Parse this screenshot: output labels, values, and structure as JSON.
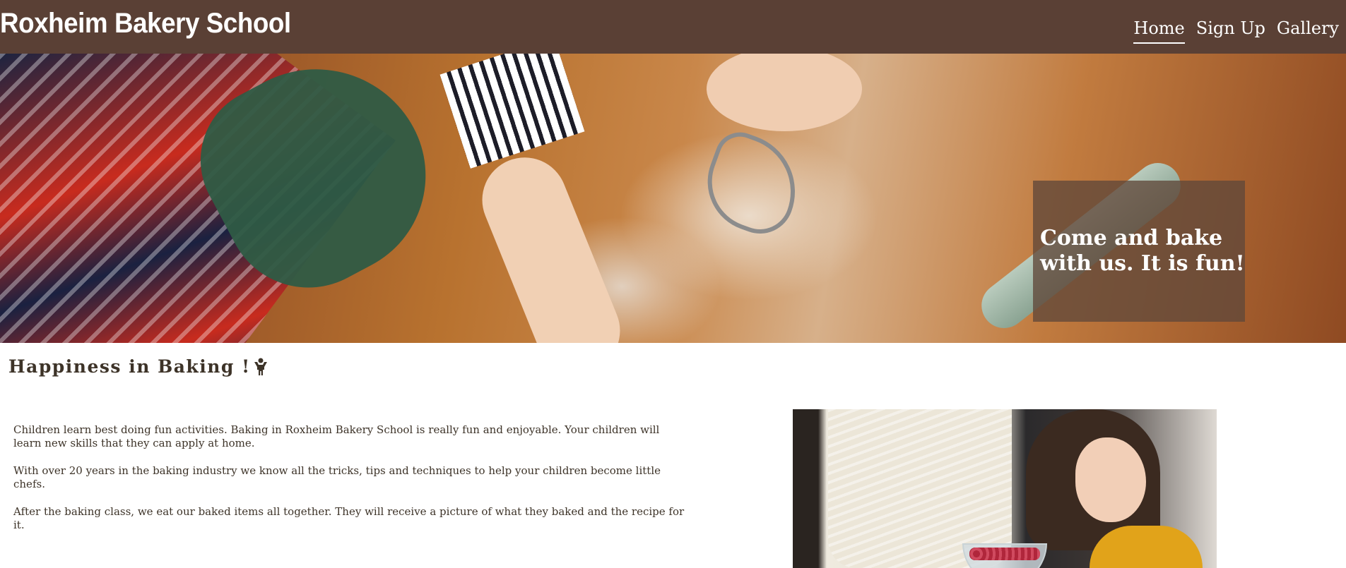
{
  "header": {
    "site_title": "Roxheim Bakery School",
    "nav": [
      {
        "label": "Home",
        "active": true
      },
      {
        "label": "Sign Up",
        "active": false
      },
      {
        "label": "Gallery",
        "active": false
      }
    ]
  },
  "hero": {
    "caption_line1": "Come and bake",
    "caption_line2": "with us. It is fun!"
  },
  "main": {
    "heading": "Happiness in Baking !",
    "heading_icon": "child-icon",
    "paragraphs": [
      "Children learn best doing fun activities. Baking in Roxheim Bakery School is really fun and enjoyable. Your children will learn new skills that they can apply at home.",
      "With over 20 years in the baking industry we know all the tricks, tips and techniques to help your children become little chefs.",
      "After the baking class, we eat our baked items all together. They will receive a picture of what they baked and the recipe for it."
    ]
  },
  "colors": {
    "header_bg": "#5a4035",
    "caption_bg": "#60483a",
    "text": "#3d3328"
  }
}
